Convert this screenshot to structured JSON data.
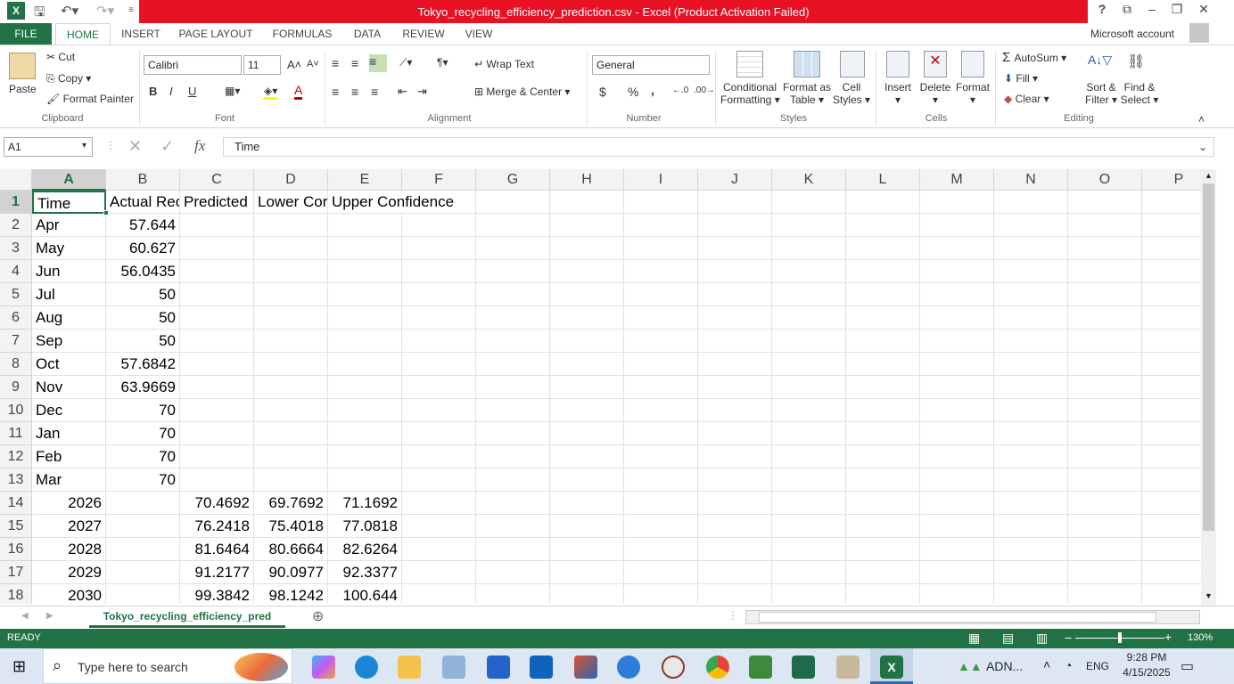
{
  "window": {
    "title": "Tokyo_recycling_efficiency_prediction.csv -  Excel (Product Activation Failed)",
    "help": "?",
    "controls": [
      "–",
      "❐",
      "✕"
    ]
  },
  "ribbon_tabs": [
    "FILE",
    "HOME",
    "INSERT",
    "PAGE LAYOUT",
    "FORMULAS",
    "DATA",
    "REVIEW",
    "VIEW"
  ],
  "account": "Microsoft account",
  "clipboard": {
    "paste": "Paste",
    "cut": "Cut",
    "copy": "Copy",
    "format_painter": "Format Painter",
    "label": "Clipboard"
  },
  "font": {
    "name": "Calibri",
    "size": "11",
    "bold": "B",
    "italic": "I",
    "underline": "U",
    "label": "Font"
  },
  "alignment": {
    "wrap": "Wrap Text",
    "merge": "Merge & Center",
    "label": "Alignment"
  },
  "number": {
    "format": "General",
    "currency": "$",
    "percent": "%",
    "comma": ",",
    "label": "Number"
  },
  "styles": {
    "conditional": "Conditional",
    "conditional2": "Formatting",
    "format_table": "Format as",
    "format_table2": "Table",
    "cell_styles": "Cell",
    "cell_styles2": "Styles",
    "label": "Styles"
  },
  "cells": {
    "insert": "Insert",
    "delete": "Delete",
    "format": "Format",
    "label": "Cells"
  },
  "editing": {
    "autosum": "AutoSum",
    "fill": "Fill",
    "clear": "Clear",
    "sort": "Sort &",
    "sort2": "Filter",
    "find": "Find &",
    "find2": "Select",
    "label": "Editing"
  },
  "formula_bar": {
    "name_box": "A1",
    "fx": "fx",
    "content": "Time"
  },
  "columns": [
    "A",
    "B",
    "C",
    "D",
    "E",
    "F",
    "G",
    "H",
    "I",
    "J",
    "K",
    "L",
    "M",
    "N",
    "O",
    "P"
  ],
  "rows": [
    {
      "n": "1",
      "A": "Time",
      "B": "Actual Rec",
      "C": "Predicted",
      "D": "Lower Cor",
      "E": "Upper Confidence"
    },
    {
      "n": "2",
      "A": "Apr",
      "B": "57.644"
    },
    {
      "n": "3",
      "A": "May",
      "B": "60.627"
    },
    {
      "n": "4",
      "A": "Jun",
      "B": "56.0435"
    },
    {
      "n": "5",
      "A": "Jul",
      "B": "50"
    },
    {
      "n": "6",
      "A": "Aug",
      "B": "50"
    },
    {
      "n": "7",
      "A": "Sep",
      "B": "50"
    },
    {
      "n": "8",
      "A": "Oct",
      "B": "57.6842"
    },
    {
      "n": "9",
      "A": "Nov",
      "B": "63.9669"
    },
    {
      "n": "10",
      "A": "Dec",
      "B": "70"
    },
    {
      "n": "11",
      "A": "Jan",
      "B": "70"
    },
    {
      "n": "12",
      "A": "Feb",
      "B": "70"
    },
    {
      "n": "13",
      "A": "Mar",
      "B": "70"
    },
    {
      "n": "14",
      "A": "2026",
      "C": "70.4692",
      "D": "69.7692",
      "E": "71.1692"
    },
    {
      "n": "15",
      "A": "2027",
      "C": "76.2418",
      "D": "75.4018",
      "E": "77.0818"
    },
    {
      "n": "16",
      "A": "2028",
      "C": "81.6464",
      "D": "80.6664",
      "E": "82.6264"
    },
    {
      "n": "17",
      "A": "2029",
      "C": "91.2177",
      "D": "90.0977",
      "E": "92.3377"
    },
    {
      "n": "18",
      "A": "2030",
      "C": "99.3842",
      "D": "98.1242",
      "E": "100.644"
    }
  ],
  "sheet_tab": "Tokyo_recycling_efficiency_pred",
  "status": {
    "mode": "READY",
    "zoom": "130%"
  },
  "taskbar": {
    "search_placeholder": "Type here to search",
    "tray_app": "ADN...",
    "lang": "ENG",
    "time": "9:28 PM",
    "date": "4/15/2025"
  },
  "colors": {
    "excel_green": "#217346",
    "title_red": "#e81123",
    "taskbar": "#dde7f3"
  }
}
